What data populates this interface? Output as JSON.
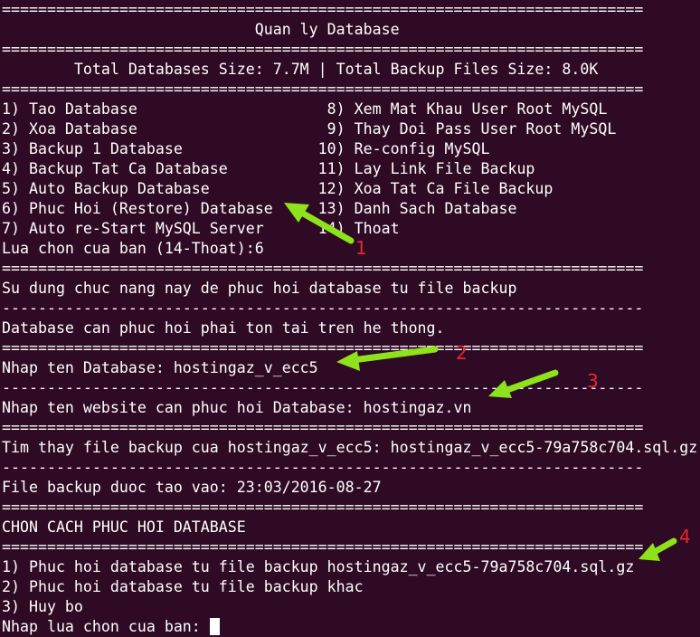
{
  "terminal": {
    "lines": [
      "=======================================================================",
      "                            Quan ly Database",
      "=======================================================================",
      "        Total Databases Size: 7.7M | Total Backup Files Size: 8.0K",
      "=======================================================================",
      "1) Tao Database                     8) Xem Mat Khau User Root MySQL",
      "2) Xoa Database                     9) Thay Doi Pass User Root MySQL",
      "3) Backup 1 Database               10) Re-config MySQL",
      "4) Backup Tat Ca Database          11) Lay Link File Backup",
      "5) Auto Backup Database            12) Xoa Tat Ca File Backup",
      "6) Phuc Hoi (Restore) Database     13) Danh Sach Database",
      "7) Auto re-Start MySQL Server      14) Thoat",
      "Lua chon cua ban (14-Thoat):6",
      "=======================================================================",
      "Su dung chuc nang nay de phuc hoi database tu file backup",
      "-----------------------------------------------------------------------",
      "Database can phuc hoi phai ton tai tren he thong.",
      "=======================================================================",
      "Nhap ten Database: hostingaz_v_ecc5",
      "-----------------------------------------------------------------------",
      "Nhap ten website can phuc hoi Database: hostingaz.vn",
      "=======================================================================",
      "Tim thay file backup cua hostingaz_v_ecc5: hostingaz_v_ecc5-79a758c704.sql.gz",
      "-----------------------------------------------------------------------",
      "File backup duoc tao vao: 23:03/2016-08-27",
      "=======================================================================",
      "CHON CACH PHUC HOI DATABASE",
      "=======================================================================",
      "1) Phuc hoi database tu file backup hostingaz_v_ecc5-79a758c704.sql.gz",
      "2) Phuc hoi database tu file backup khac",
      "3) Huy bo"
    ],
    "prompt": "Nhap lua chon cua ban: "
  },
  "annotations": {
    "color_arrow": "#8de21c",
    "color_number": "#e8262c",
    "labels": [
      "1",
      "2",
      "3",
      "4"
    ]
  }
}
